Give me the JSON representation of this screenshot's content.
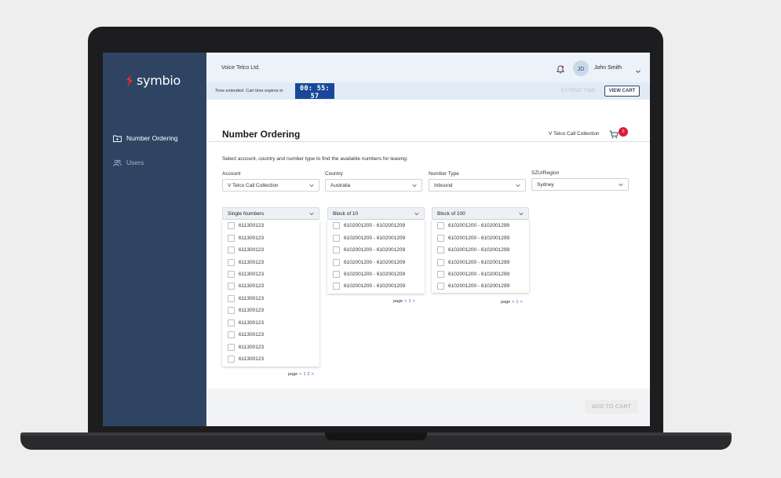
{
  "brand": {
    "name": "symbio",
    "accent": "#e8273c",
    "sidebar_bg": "#2e4462"
  },
  "sidebar": {
    "items": [
      {
        "label": "Number Ordering",
        "icon": "folder-icon"
      },
      {
        "label": "Users",
        "icon": "users-icon"
      }
    ]
  },
  "header": {
    "company": "Voice Telco Ltd.",
    "user_initials": "JD",
    "user_name": "John Smith"
  },
  "timer": {
    "message": "Time extended. Cart time expires in",
    "value": "00: 55: 57",
    "units": [
      "hrs",
      "mins",
      "secs"
    ],
    "extend_label": "EXTEND TIME",
    "view_cart_label": "VIEW CART"
  },
  "page": {
    "title": "Number Ordering",
    "cart_label": "V Telco Call Collection",
    "cart_count": "0",
    "instruction": "Select account, country and number type to find the available numbers for leasing:"
  },
  "filters": {
    "account": {
      "label": "Account",
      "value": "V Telco Call Collection"
    },
    "country": {
      "label": "Country",
      "value": "Australia"
    },
    "number_type": {
      "label": "Number Type",
      "value": "Inbound"
    },
    "region": {
      "label": "SZU/Region",
      "value": "Sydney"
    }
  },
  "lists": {
    "single": {
      "label": "Single Numbers",
      "items": [
        "611300123",
        "611300123",
        "611300123",
        "611300123",
        "611300123",
        "611300123",
        "611300123",
        "611300123",
        "611300123",
        "611300123",
        "611300123",
        "611300123"
      ],
      "pager": {
        "word": "page",
        "prev": "<",
        "pages": [
          "1",
          "2"
        ],
        "next": ">"
      }
    },
    "block10": {
      "label": "Block of 10",
      "items": [
        "6102001200 - 6102001209",
        "6102001200 - 6102001209",
        "6102001200 - 6102001209",
        "6102001200 - 6102001209",
        "6102001200 - 6102001209",
        "6102001200 - 6102001209"
      ],
      "pager": {
        "word": "page",
        "prev": "<",
        "pages": [
          "1"
        ],
        "next": ">"
      }
    },
    "block100": {
      "label": "Block of 100",
      "items": [
        "6102001200 - 6102001299",
        "6102001200 - 6102001299",
        "6102001200 - 6102001299",
        "6102001200 - 6102001299",
        "6102001200 - 6102001299",
        "6102001200 - 6102001299"
      ],
      "pager": {
        "word": "page",
        "prev": "<",
        "pages": [
          "1"
        ],
        "next": ">"
      }
    }
  },
  "footer": {
    "add_to_cart_label": "ADD TO CART"
  }
}
